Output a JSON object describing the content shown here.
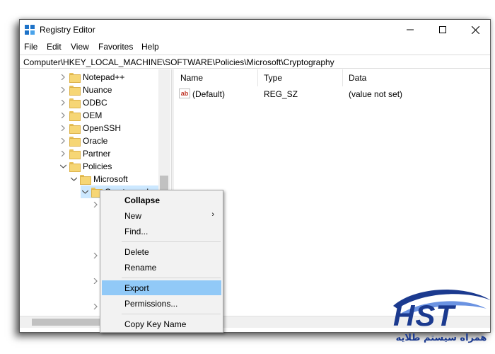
{
  "window": {
    "title": "Registry Editor"
  },
  "menu": [
    "File",
    "Edit",
    "View",
    "Favorites",
    "Help"
  ],
  "address": "Computer\\HKEY_LOCAL_MACHINE\\SOFTWARE\\Policies\\Microsoft\\Cryptography",
  "tree": {
    "items": [
      "Notepad++",
      "Nuance",
      "ODBC",
      "OEM",
      "OpenSSH",
      "Oracle",
      "Partner",
      "Policies",
      "Microsoft",
      "Cryptography"
    ]
  },
  "list": {
    "headers": [
      "Name",
      "Type",
      "Data"
    ],
    "rows": [
      {
        "name": "(Default)",
        "type": "REG_SZ",
        "data": "(value not set)"
      }
    ]
  },
  "context_menu": {
    "items": [
      "Collapse",
      "New",
      "Find...",
      "Delete",
      "Rename",
      "Export",
      "Permissions...",
      "Copy Key Name"
    ],
    "highlighted": "Export"
  },
  "watermark": {
    "logo_text": "HST",
    "subtitle": "همراه سیستم طلایه"
  },
  "colors": {
    "selection": "#cce8ff",
    "menu_highlight": "#91c9f7",
    "logo": "#1b3a8f"
  }
}
